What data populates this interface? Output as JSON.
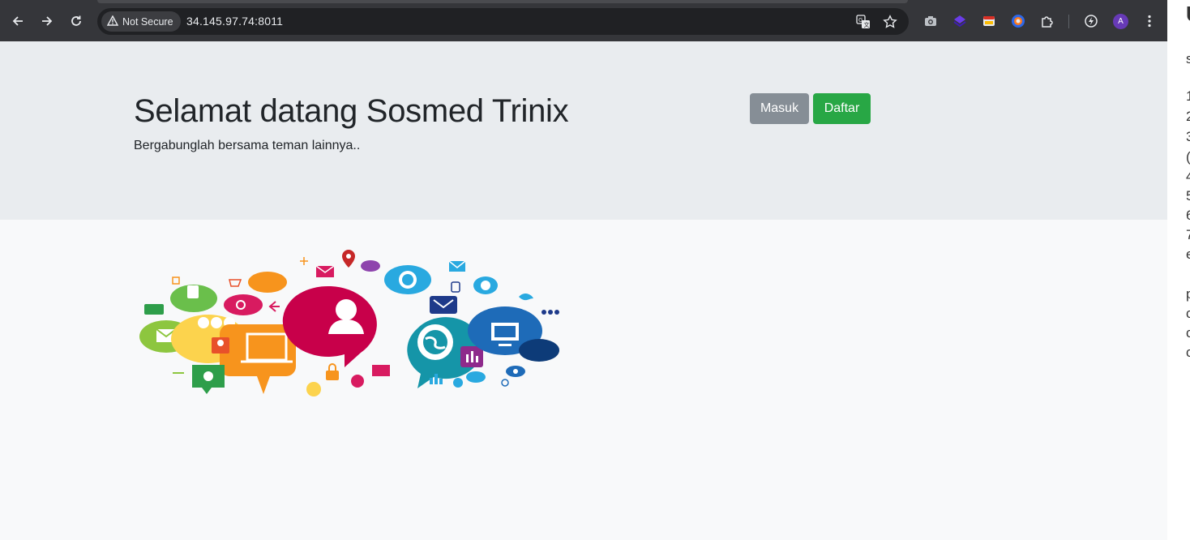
{
  "browser": {
    "security_label": "Not Secure",
    "url": "34.145.97.74:8011",
    "avatar_letter": "A"
  },
  "hero": {
    "title": "Selamat datang Sosmed Trinix",
    "subtitle": "Bergabunglah bersama teman lainnya..",
    "login_label": "Masuk",
    "register_label": "Daftar"
  },
  "side_panel": {
    "fragments": [
      "U",
      "s",
      "1",
      "2",
      "3",
      "(",
      "4",
      "5",
      "6",
      "7",
      "e",
      "p",
      "c",
      "c",
      "c"
    ]
  },
  "colors": {
    "toolbar": "#35363a",
    "hero_bg": "#e9ecef",
    "page_bg": "#f8f9fa",
    "login_button": "#868e96",
    "register_button": "#28a745"
  }
}
